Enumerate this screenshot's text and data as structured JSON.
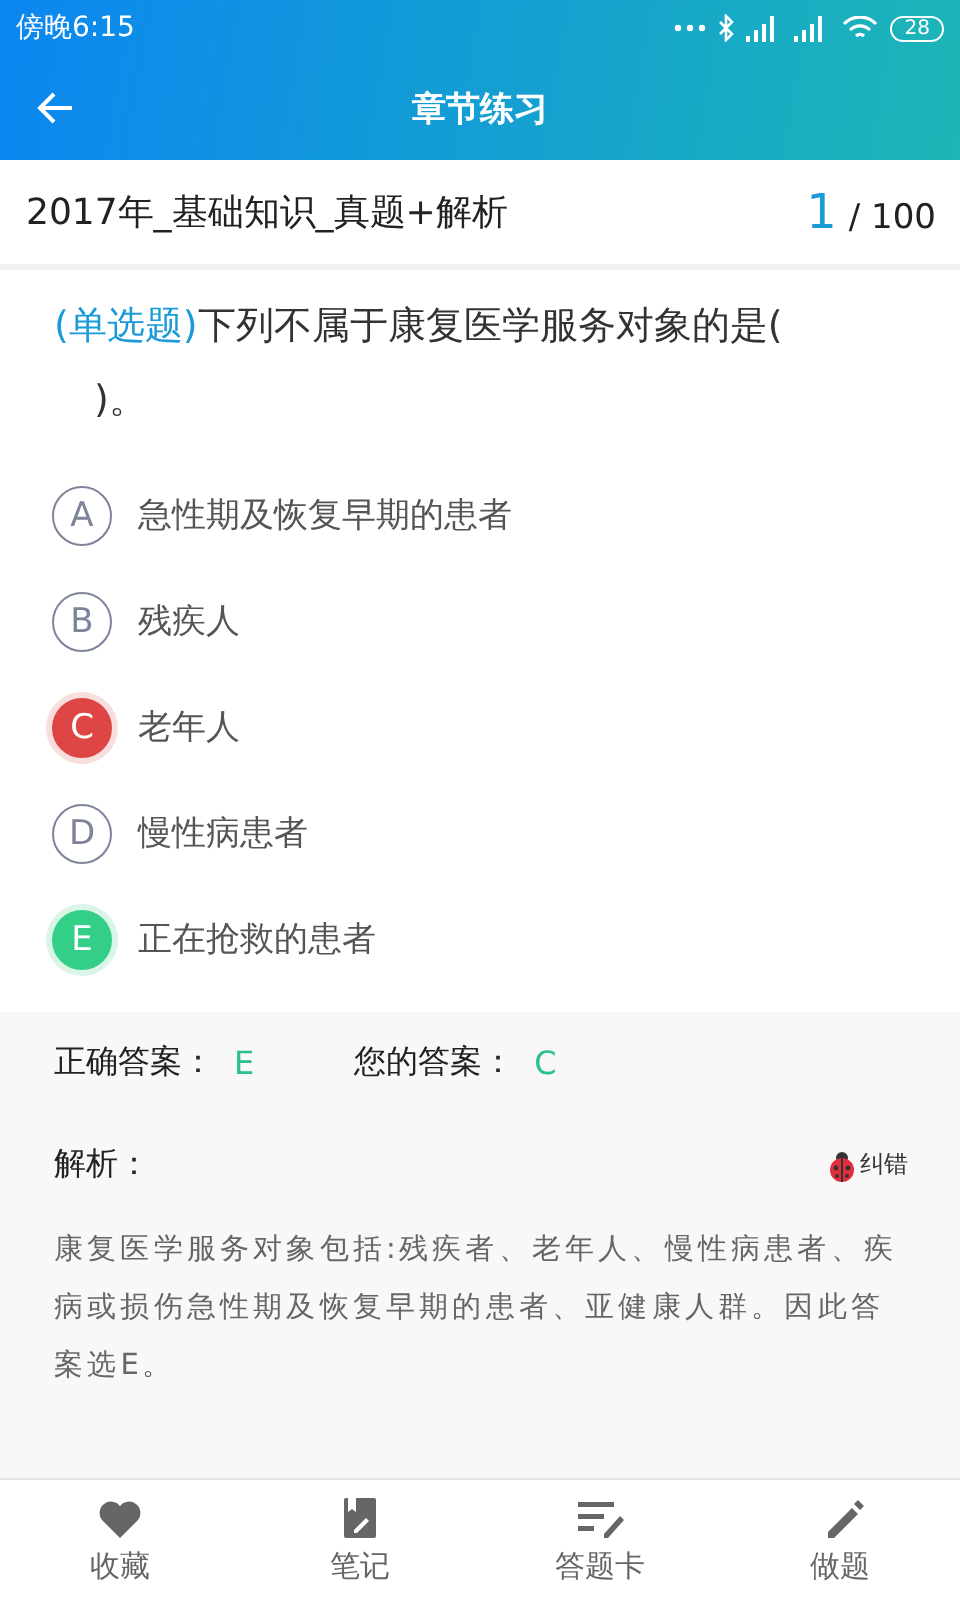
{
  "status_bar": {
    "time": "傍晚6:15",
    "battery": "28"
  },
  "nav": {
    "title": "章节练习"
  },
  "paper": {
    "title": "2017年_基础知识_真题+解析",
    "current": "1",
    "total": "/ 100"
  },
  "question": {
    "type": "(单选题)",
    "text": "下列不属于康复医学服务对象的是(  )。"
  },
  "options": [
    {
      "letter": "A",
      "text": "急性期及恢复早期的患者",
      "selected": false,
      "correct": false
    },
    {
      "letter": "B",
      "text": "残疾人",
      "selected": false,
      "correct": false
    },
    {
      "letter": "C",
      "text": "老年人",
      "selected": true,
      "correct": false
    },
    {
      "letter": "D",
      "text": "慢性病患者",
      "selected": false,
      "correct": false
    },
    {
      "letter": "E",
      "text": "正在抢救的患者",
      "selected": false,
      "correct": true
    }
  ],
  "answer": {
    "correct_label": "正确答案：",
    "correct_value": "E",
    "yours_label": "您的答案：",
    "yours_value": "C"
  },
  "analysis": {
    "title": "解析：",
    "report": "纠错",
    "text": "康复医学服务对象包括:残疾者、老年人、慢性病患者、疾病或损伤急性期及恢复早期的患者、亚健康人群。因此答案选E。"
  },
  "tabbar": [
    {
      "kind": "heart",
      "label": "收藏"
    },
    {
      "kind": "note",
      "label": "笔记"
    },
    {
      "kind": "card",
      "label": "答题卡"
    },
    {
      "kind": "pencil",
      "label": "做题"
    }
  ]
}
